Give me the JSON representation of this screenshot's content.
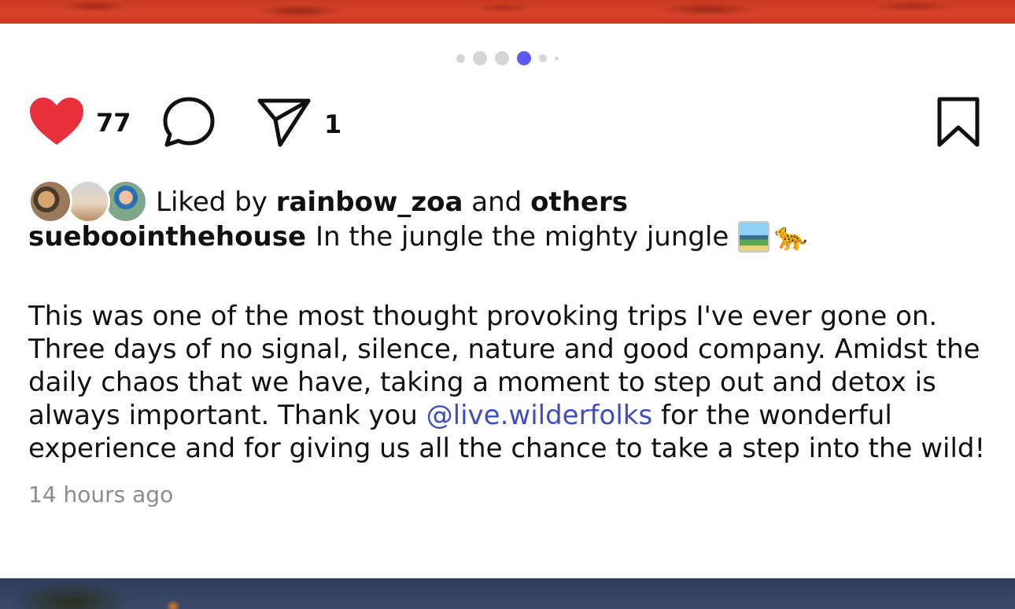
{
  "carousel": {
    "dot_count": 6,
    "active_index": 3
  },
  "actions": {
    "like_count": "77",
    "share_count": "1",
    "liked": true,
    "like_color": "#e8303c"
  },
  "liked_by": {
    "prefix": "Liked by",
    "user": "rainbow_zoa",
    "connector": "and",
    "others": "others"
  },
  "post": {
    "username": "sueboointhehouse",
    "caption_title": "In the jungle the mighty jungle",
    "emojis": [
      "national-park-emoji",
      "leopard-emoji"
    ],
    "body_part1": "This was one of the most thought provoking trips I've ever gone on. Three days of no signal, silence, nature and good company. Amidst the daily chaos that we have, taking a moment to step out and detox is always important. Thank you",
    "mention": "@live.wilderfolks",
    "body_part2": "for the wonderful experience and for giving us all the chance to take a step into the wild!",
    "timestamp": "14 hours ago",
    "mention_color": "#3f4dbd"
  },
  "colors": {
    "active_dot": "#5b5bf0",
    "inactive_dot": "#d6d6d6"
  }
}
